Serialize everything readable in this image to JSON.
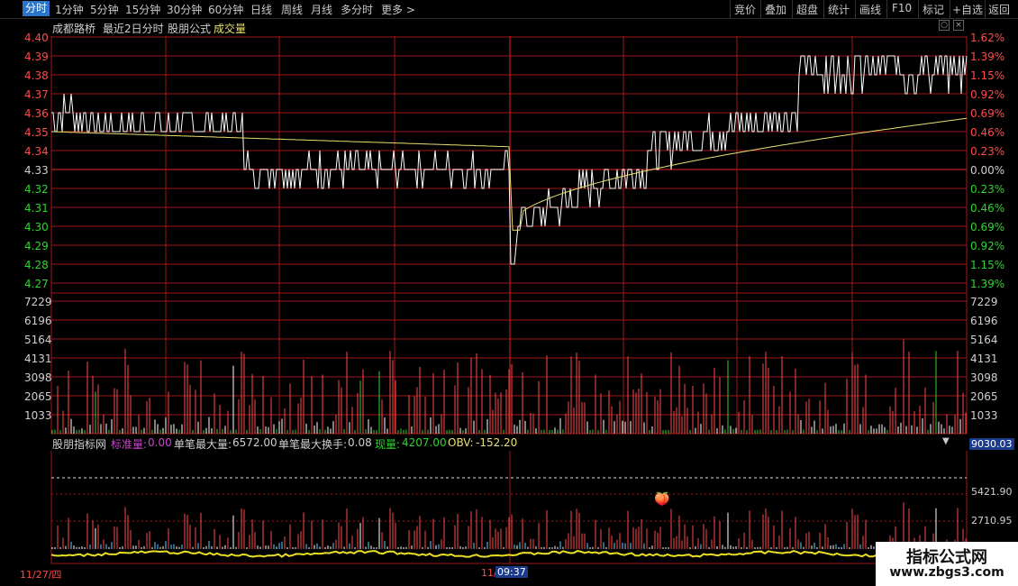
{
  "toolbar": {
    "periods": [
      "分时",
      "1分钟",
      "5分钟",
      "15分钟",
      "30分钟",
      "60分钟",
      "日线",
      "周线",
      "月线",
      "多分时",
      "更多 >"
    ],
    "right_buttons": [
      "竞价",
      "叠加",
      "超盘",
      "统计",
      "画线",
      "F10",
      "标记",
      "+自选",
      "返回"
    ]
  },
  "header": {
    "stock_name": "成都路桥",
    "mode": "最近2日分时",
    "formula": "股朋公式",
    "indicator": "成交量"
  },
  "price_axis": {
    "left": [
      "4.40",
      "4.39",
      "4.38",
      "4.37",
      "4.36",
      "4.35",
      "4.34",
      "4.33",
      "4.32",
      "4.31",
      "4.30",
      "4.29",
      "4.28",
      "4.27"
    ],
    "right": [
      "1.62%",
      "1.39%",
      "1.15%",
      "0.92%",
      "0.69%",
      "0.46%",
      "0.23%",
      "0.00%",
      "0.23%",
      "0.46%",
      "0.69%",
      "0.92%",
      "1.15%",
      "1.39%"
    ]
  },
  "volume_axis": [
    "7229",
    "6196",
    "5164",
    "4131",
    "3098",
    "2065",
    "1033"
  ],
  "indicator_bar": {
    "name": "股朋指标网",
    "std_label": "标准量:",
    "std_value": "0.00",
    "max_label": "单笔最大量:",
    "max_value": "6572.00",
    "turnover_label": "单笔最大换手:",
    "turnover_value": "0.08",
    "now_label": "现量:",
    "now_value": "4207.00",
    "obv_label": "OBV:",
    "obv_value": "-152.20",
    "top_value": "9030.03"
  },
  "lower_axis": [
    "5421.90",
    "2710.95"
  ],
  "dates": {
    "d1": "11/27/四",
    "d2": "11/",
    "time": "09:37"
  },
  "watermark": {
    "line1": "指标公式网",
    "line2": "www.zbgs3.com"
  },
  "colors": {
    "grid": "#a01818",
    "price": "#ffffff",
    "avg": "#e8e070",
    "up": "#ff4a4a",
    "down": "#2ed52e"
  }
}
